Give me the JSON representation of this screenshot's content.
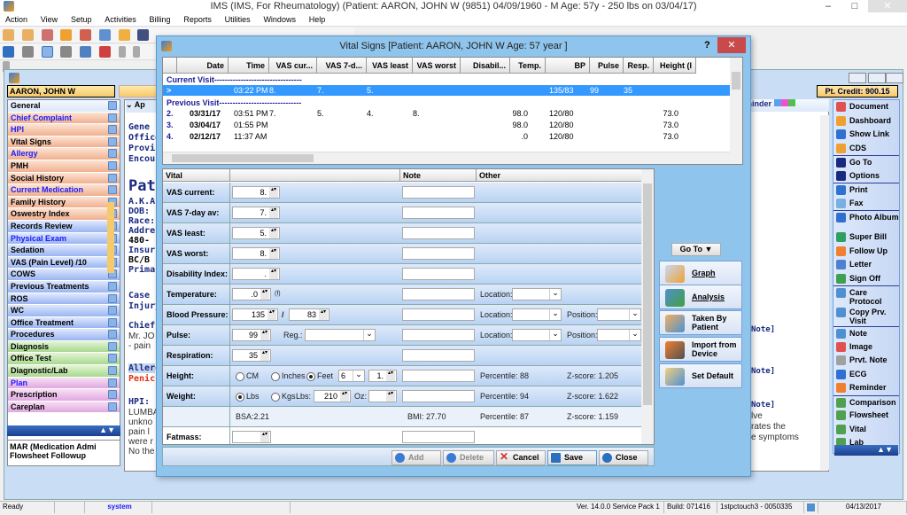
{
  "app": {
    "title": "IMS (IMS, For Rheumatology)    (Patient: AARON, JOHN W (9851) 04/09/1960 - M Age: 57y  - 250 lbs on 03/04/17)",
    "window_controls": {
      "minimize": "–",
      "restore": "□",
      "close": "✕"
    }
  },
  "menu": [
    "Action",
    "View",
    "Setup",
    "Activities",
    "Billing",
    "Reports",
    "Utilities",
    "Windows",
    "Help"
  ],
  "patient": {
    "name": "AARON, JOHN W",
    "credit": "Pt. Credit: 900.15"
  },
  "left_nav": {
    "items": [
      {
        "label": "General",
        "style": "general",
        "link": false
      },
      {
        "label": "Chief Complaint",
        "style": "orange",
        "link": true
      },
      {
        "label": "HPI",
        "style": "orange",
        "link": true
      },
      {
        "label": "Vital Signs",
        "style": "orange",
        "link": false
      },
      {
        "label": "Allergy",
        "style": "orange",
        "link": true
      },
      {
        "label": "PMH",
        "style": "orange",
        "link": false
      },
      {
        "label": "Social History",
        "style": "orange",
        "link": false
      },
      {
        "label": "Current Medication",
        "style": "orange",
        "link": true
      },
      {
        "label": "Family History",
        "style": "orange",
        "link": false
      },
      {
        "label": "Oswestry Index",
        "style": "orange",
        "link": false
      },
      {
        "label": "Records Review",
        "style": "blue",
        "link": false
      },
      {
        "label": "Physical Exam",
        "style": "blue",
        "link": true
      },
      {
        "label": "Sedation",
        "style": "blue",
        "link": false
      },
      {
        "label": "VAS (Pain Level)  /10",
        "style": "blue",
        "link": false
      },
      {
        "label": "COWS",
        "style": "blue",
        "link": false
      },
      {
        "label": "Previous Treatments",
        "style": "blue",
        "link": false
      },
      {
        "label": "ROS",
        "style": "blue",
        "link": false
      },
      {
        "label": "WC",
        "style": "blue",
        "link": false
      },
      {
        "label": "Office Treatment",
        "style": "blue",
        "link": false
      },
      {
        "label": "Procedures",
        "style": "blue",
        "link": false
      },
      {
        "label": "Diagnosis",
        "style": "green",
        "link": false
      },
      {
        "label": "Office Test",
        "style": "green",
        "link": false
      },
      {
        "label": "Diagnostic/Lab",
        "style": "green",
        "link": false
      },
      {
        "label": "Plan",
        "style": "pink",
        "link": true
      },
      {
        "label": "Prescription",
        "style": "pink",
        "link": false
      },
      {
        "label": "Careplan",
        "style": "pink",
        "link": false
      }
    ],
    "bottom_list": [
      "MAR (Medication Admi",
      "Flowsheet Followup"
    ]
  },
  "content": {
    "tab_label": "Ap",
    "lines": [
      {
        "text": "Gene",
        "color": "#1a2a80"
      },
      {
        "text": "Office",
        "color": "#1a2a80"
      },
      {
        "text": "Provi",
        "color": "#1a2a80"
      },
      {
        "text": "Encou",
        "color": "#1a2a80"
      }
    ],
    "patient_heading": "Pat",
    "patient_lines": [
      "A.K.A",
      "DOB:",
      "Race:",
      "Addre",
      "480-",
      "Insur",
      "BC/B",
      "Prima"
    ],
    "case_lines": [
      "Case",
      "Injury"
    ],
    "chief_heading": "Chief",
    "chief_lines": [
      "Mr. JO",
      "- pain"
    ],
    "allergy_heading": "Allerg",
    "allergy_value": "Penic",
    "hpi_heading": "HPI:",
    "hpi_lines": [
      "LUMBA",
      "unkno",
      "pain l",
      "were r",
      "No the"
    ],
    "right_fragments": [
      "Note]",
      "Note]",
      "Note]",
      "lve",
      "rates the",
      "e symptoms"
    ],
    "reminder_label": "eminder"
  },
  "right_actions": [
    {
      "label": "Document",
      "icon": "document-icon",
      "color": "#e05050"
    },
    {
      "label": "Dashboard",
      "icon": "dashboard-icon",
      "color": "#f0a030"
    },
    {
      "label": "Show Link",
      "icon": "link-icon",
      "color": "#3070d0"
    },
    {
      "label": "CDS",
      "icon": "cds-icon",
      "color": "#f0a030",
      "sep_after": true
    },
    {
      "label": "Go To",
      "icon": "triangle-down-icon",
      "color": "#1a2a80"
    },
    {
      "label": "Options",
      "icon": "triangle-down-icon",
      "color": "#1a2a80",
      "sep_after": true
    },
    {
      "label": "Print",
      "icon": "print-icon",
      "color": "#3070d0"
    },
    {
      "label": "Fax",
      "icon": "fax-icon",
      "color": "#7ab0e0",
      "sep_after": true
    },
    {
      "label": "Photo Album",
      "icon": "photo-icon",
      "color": "#3070d0",
      "two": true
    },
    {
      "label": "Super Bill",
      "icon": "bill-icon",
      "color": "#30a060"
    },
    {
      "label": "Follow Up",
      "icon": "calendar-icon",
      "color": "#f08030"
    },
    {
      "label": "Letter",
      "icon": "letter-icon",
      "color": "#5080d0"
    },
    {
      "label": "Sign Off",
      "icon": "sign-off-icon",
      "color": "#40a050",
      "sep_after": true
    },
    {
      "label": "Care Protocol",
      "icon": "protocol-icon",
      "color": "#5090d0",
      "two": true
    },
    {
      "label": "Copy Prv. Visit",
      "icon": "copy-icon",
      "color": "#5090d0",
      "two": true,
      "sep_after": true
    },
    {
      "label": "Note",
      "icon": "note-icon",
      "color": "#5090d0"
    },
    {
      "label": "Image",
      "icon": "image-icon",
      "color": "#e05050"
    },
    {
      "label": "Prvt. Note",
      "icon": "private-note-icon",
      "color": "#a0a0a0"
    },
    {
      "label": "ECG",
      "icon": "ecg-icon",
      "color": "#3070d0"
    },
    {
      "label": "Reminder",
      "icon": "reminder-icon",
      "color": "#f08030",
      "sep_after": true
    },
    {
      "label": "Comparison",
      "icon": "comparison-icon",
      "color": "#50a050"
    },
    {
      "label": "Flowsheet",
      "icon": "flowsheet-icon",
      "color": "#50a050"
    },
    {
      "label": "Vital",
      "icon": "vital-icon",
      "color": "#50a050"
    },
    {
      "label": "Lab",
      "icon": "lab-icon",
      "color": "#50a050"
    }
  ],
  "dialog": {
    "title": "Vital Signs  [Patient: AARON, JOHN W  Age: 57 year ]",
    "help": "?",
    "close": "✕",
    "grid": {
      "columns": [
        "",
        "Date",
        "Time",
        "VAS cur...",
        "VAS 7-d...",
        "VAS least",
        "VAS worst",
        "Disabil...",
        "Temp.",
        "BP",
        "Pulse",
        "Resp.",
        "Height (I"
      ],
      "current_visit_label": "Current Visit---------------------------------",
      "previous_visit_label": "Previous Visit-------------------------------",
      "current_row": {
        "marker": ">",
        "date": "",
        "time": "03:22 PM",
        "vas_cur": "8.",
        "vas_7d": "7.",
        "vas_least": "5.",
        "vas_worst": "",
        "disab": "",
        "temp": "",
        "bp": "135/83",
        "pulse": "99",
        "resp": "35",
        "height": ""
      },
      "previous_rows": [
        {
          "marker": "2.",
          "date": "03/31/17",
          "time": "03:51 PM",
          "vas_cur": "7.",
          "vas_7d": "5.",
          "vas_least": "4.",
          "vas_worst": "8.",
          "disab": "",
          "temp": "98.0",
          "bp": "120/80",
          "pulse": "",
          "resp": "",
          "height": "73.0"
        },
        {
          "marker": "3.",
          "date": "03/04/17",
          "time": "01:55 PM",
          "vas_cur": "",
          "vas_7d": "",
          "vas_least": "",
          "vas_worst": "",
          "disab": "",
          "temp": "98.0",
          "bp": "120/80",
          "pulse": "",
          "resp": "",
          "height": "73.0"
        },
        {
          "marker": "4.",
          "date": "02/12/17",
          "time": "11:37 AM",
          "vas_cur": "",
          "vas_7d": "",
          "vas_least": "",
          "vas_worst": "",
          "disab": "",
          "temp": ".0",
          "bp": "120/80",
          "pulse": "",
          "resp": "",
          "height": "73.0"
        }
      ]
    },
    "form": {
      "headers": {
        "vital": "Vital",
        "value": "",
        "note": "Note",
        "other": "Other"
      },
      "rows": {
        "vas_current": {
          "label": "VAS current:",
          "value": "8."
        },
        "vas_7day": {
          "label": "VAS 7-day av:",
          "value": "7."
        },
        "vas_least": {
          "label": "VAS least:",
          "value": "5."
        },
        "vas_worst": {
          "label": "VAS worst:",
          "value": "8."
        },
        "disability": {
          "label": "Disability Index:",
          "value": "."
        },
        "temperature": {
          "label": "Temperature:",
          "value": ".0",
          "unit": "(f)",
          "location_label": "Location:",
          "location_value": ""
        },
        "bp": {
          "label": "Blood Pressure:",
          "systolic": "135",
          "sep": "/",
          "diastolic": "83",
          "location_label": "Location:",
          "position_label": "Position:"
        },
        "pulse": {
          "label": "Pulse:",
          "value": "99",
          "reg_label": "Reg.:",
          "reg_value": "",
          "location_label": "Location:",
          "position_label": "Position:"
        },
        "respiration": {
          "label": "Respiration:",
          "value": "35"
        },
        "height": {
          "label": "Height:",
          "opt_cm": "CM",
          "opt_inches": "Inches",
          "opt_feet": "Feet",
          "selected": "Feet",
          "feet": "6",
          "inches": "1.",
          "percentile": "Percentile: 88",
          "zscore": "Z-score: 1.205"
        },
        "weight": {
          "label": "Weight:",
          "opt_lbs": "Lbs",
          "opt_kgs": "Kgs",
          "selected": "Lbs",
          "lbs_label": "Lbs:",
          "lbs": "210",
          "oz_label": "Oz:",
          "oz": "",
          "percentile": "Percentile: 94",
          "zscore": "Z-score: 1.622"
        },
        "bsa": {
          "bsa": "BSA:2.21",
          "bmi": "BMI: 27.70",
          "percentile": "Percentile: 87",
          "zscore": "Z-score: 1.159"
        },
        "fatmass": {
          "label": "Fatmass:",
          "value": ""
        }
      }
    },
    "side_panel": {
      "goto_label": "Go To",
      "buttons": [
        {
          "label": "Graph",
          "icon": "graph-icon"
        },
        {
          "label": "Analysis",
          "icon": "analysis-icon"
        },
        {
          "label": "Taken By Patient",
          "icon": "patient-icon"
        },
        {
          "label": "Import from Device",
          "icon": "device-icon"
        },
        {
          "label": "Set Default",
          "icon": "set-default-icon"
        }
      ]
    },
    "buttons": {
      "add": "Add",
      "delete": "Delete",
      "cancel": "Cancel",
      "save": "Save",
      "close": "Close"
    }
  },
  "statusbar": {
    "status": "Ready",
    "user": "system",
    "version": "Ver. 14.0.0 Service Pack 1",
    "build": "Build: 071416",
    "server": "1stpctouch3 - 0050335",
    "date": "04/13/2017"
  }
}
